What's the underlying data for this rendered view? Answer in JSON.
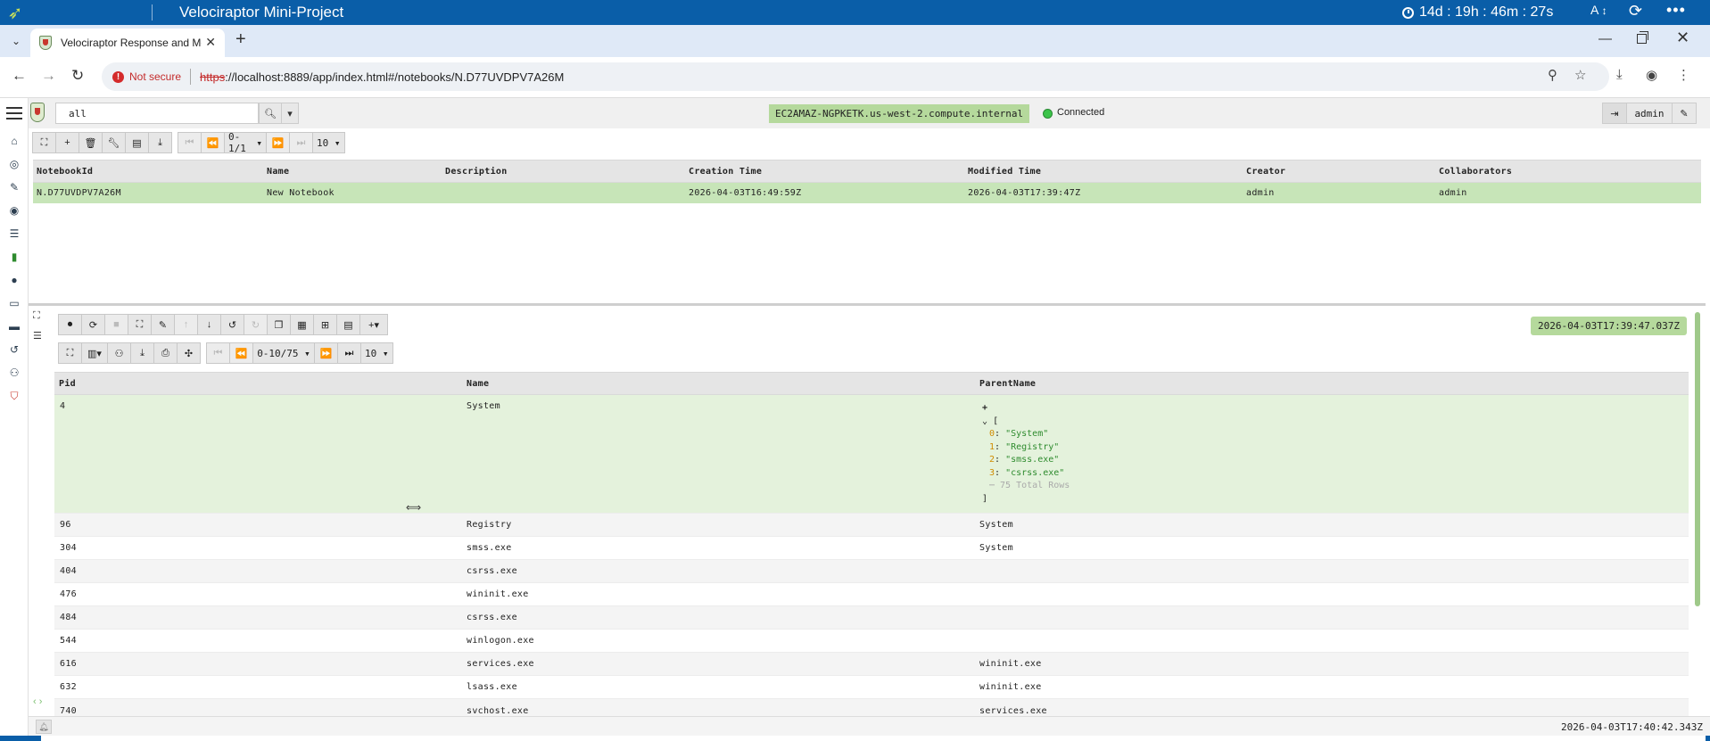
{
  "os": {
    "title": "Velociraptor Mini-Project",
    "timer": "14d : 19h : 46m : 27s",
    "font_label": "A"
  },
  "browser": {
    "tab_title": "Velociraptor Response and Mon",
    "not_secure": "Not secure",
    "url_scheme": "https",
    "url_rest": "://localhost:8889/app/index.html#/notebooks/N.D77UVDPV7A26M"
  },
  "app": {
    "search_value": "all",
    "hostname": "EC2AMAZ-NGPKETK.us-west-2.compute.internal",
    "connection_status": "Connected",
    "user": "admin"
  },
  "notebooks_toolbar": {
    "page_range": "0-1/1",
    "page_size": "10"
  },
  "notebooks": {
    "columns": [
      "NotebookId",
      "Name",
      "Description",
      "Creation Time",
      "Modified Time",
      "Creator",
      "Collaborators"
    ],
    "rows": [
      [
        "N.D77UVDPV7A26M",
        "New Notebook",
        "",
        "2026-04-03T16:49:59Z",
        "2026-04-03T17:39:47Z",
        "admin",
        "admin"
      ]
    ]
  },
  "cell": {
    "timestamp": "2026-04-03T17:39:47.037Z",
    "page_range": "0-10/75",
    "page_size": "10"
  },
  "results": {
    "columns": [
      "Pid",
      "Name",
      "ParentName"
    ],
    "expand_plus": "+",
    "json_open": "[",
    "json_close": "]",
    "json_items": [
      {
        "k": "0",
        "v": "\"System\""
      },
      {
        "k": "1",
        "v": "\"Registry\""
      },
      {
        "k": "2",
        "v": "\"smss.exe\""
      },
      {
        "k": "3",
        "v": "\"csrss.exe\""
      }
    ],
    "json_more": "⋯ 75 Total Rows",
    "rows": [
      {
        "pid": "4",
        "name": "System",
        "parent": ""
      },
      {
        "pid": "96",
        "name": "Registry",
        "parent": "System"
      },
      {
        "pid": "304",
        "name": "smss.exe",
        "parent": "System"
      },
      {
        "pid": "404",
        "name": "csrss.exe",
        "parent": ""
      },
      {
        "pid": "476",
        "name": "wininit.exe",
        "parent": ""
      },
      {
        "pid": "484",
        "name": "csrss.exe",
        "parent": ""
      },
      {
        "pid": "544",
        "name": "winlogon.exe",
        "parent": ""
      },
      {
        "pid": "616",
        "name": "services.exe",
        "parent": "wininit.exe"
      },
      {
        "pid": "632",
        "name": "lsass.exe",
        "parent": "wininit.exe"
      },
      {
        "pid": "740",
        "name": "svchost.exe",
        "parent": "services.exe"
      }
    ]
  },
  "footer": {
    "time": "2026-04-03T17:40:42.343Z"
  }
}
